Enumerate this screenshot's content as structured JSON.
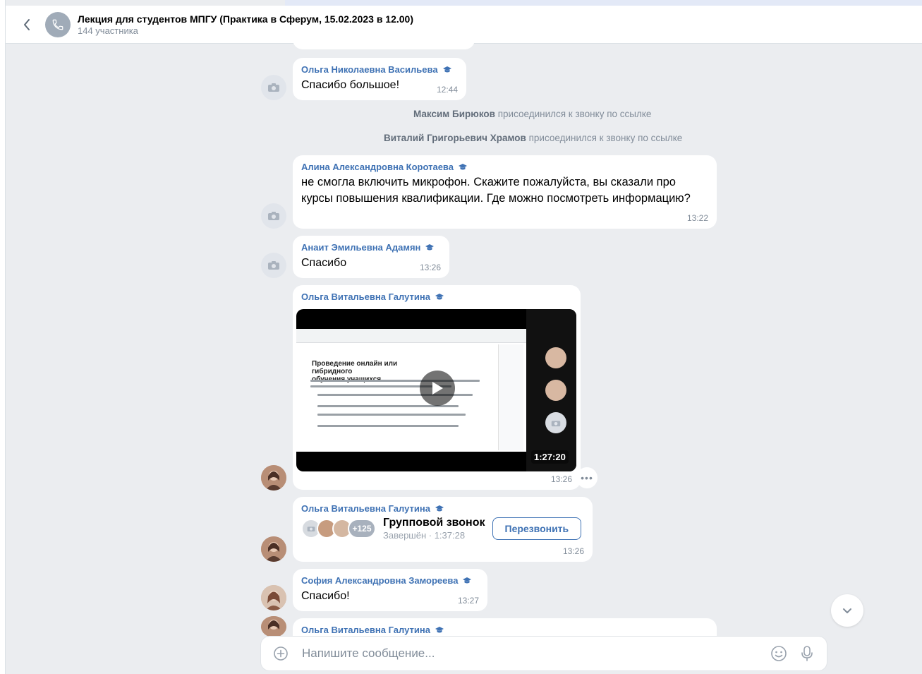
{
  "header": {
    "title": "Лекция для студентов МПГУ (Практика в Сферум, 15.02.2023 в 12.00)",
    "subtitle": "144 участника"
  },
  "messages": [
    {
      "author": "Ольга Николаевна Васильева",
      "text": "Спасибо большое!",
      "time": "12:44"
    },
    {
      "author": "Алина Александровна Коротаева",
      "text_line1": "не смогла включить микрофон. Скажите пожалуйста, вы сказали про",
      "text_line2": "курсы повышения квалификации. Где можно посмотреть информацию?",
      "time": "13:22"
    },
    {
      "author": "Анаит Эмильевна Адамян",
      "text": "Спасибо",
      "time": "13:26"
    },
    {
      "author": "Ольга Витальевна Галутина",
      "time": "13:26",
      "video": {
        "duration": "1:27:20",
        "slide_title_line1": "Проведение онлайн или гибридного",
        "slide_title_line2": "обучения учащихся"
      }
    },
    {
      "author": "Ольга Витальевна Галутина",
      "time": "13:26",
      "call": {
        "title": "Групповой звонок",
        "status": "Завершён · 1:37:28",
        "extra_count": "+125",
        "button": "Перезвонить"
      }
    },
    {
      "author": "София Александровна Заморeева",
      "text": "Спасибо!",
      "time": "13:27"
    },
    {
      "author": "Ольга Витальевна Галутина"
    }
  ],
  "service": [
    {
      "name": "Максим Бирюков",
      "action": "присоединился к звонку по ссылке"
    },
    {
      "name": "Виталий Григорьевич Храмов",
      "action": "присоединился к звонку по ссылке"
    }
  ],
  "composer": {
    "placeholder": "Напишите сообщение..."
  },
  "colors": {
    "accent": "#3f72b4",
    "background": "#ebedf0",
    "bubble": "#ffffff",
    "secondary_text": "#818c99"
  },
  "icons": [
    "back-chevron-icon",
    "phone-icon",
    "camera-icon",
    "graduation-cap-icon",
    "play-icon",
    "more-icon",
    "chevron-down-icon",
    "add-icon",
    "emoji-icon",
    "microphone-icon"
  ]
}
